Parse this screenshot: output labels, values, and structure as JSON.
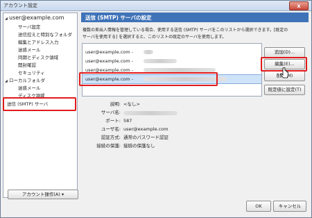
{
  "window": {
    "title": "アカウント設定",
    "close_glyph": "x"
  },
  "sidebar": {
    "account": "user@example.com",
    "account_items": [
      "サーバ設定",
      "送信控えと特別なフォルダ",
      "編集とアドレス入力",
      "迷惑メール",
      "同期とディスク領域",
      "開封確認",
      "セキュリティ"
    ],
    "local": "ローカルフォルダ",
    "local_items": [
      "迷惑メール",
      "ディスク領域"
    ],
    "smtp": "送信 (SMTP) サーバ",
    "account_actions": "アカウント操作(A)"
  },
  "panel": {
    "title": "送信 (SMTP) サーバの設定",
    "description_1": "複数の差出人情報を管理している場合、使用する送信 (SMTP) サーバをこのリストから選択できます。[既定の",
    "description_2": "サーバを使用する] を選択すると、このリストの既定のサーバを使用します。"
  },
  "servers": [
    {
      "email": "user@example.com",
      "dash": "-"
    },
    {
      "email": "user@example.com",
      "dash": "-"
    },
    {
      "email": "user@example.com",
      "dash": "-"
    },
    {
      "email": "user@example.com",
      "dash": "-",
      "selected": true
    }
  ],
  "buttons": {
    "add": "追加(D)...",
    "edit": "編集(E)...",
    "remove": "削除(M)",
    "set_default": "既定値に設定(T)",
    "ok": "OK",
    "cancel": "キャンセル",
    "account_dropdown_glyph": "▾"
  },
  "details": {
    "description_label": "説明:",
    "description_value": "<なし>",
    "server_label": "サーバ名:",
    "port_label": "ポート:",
    "port_value": "587",
    "username_label": "ユーザ名:",
    "username_value": "user@example.com",
    "auth_label": "認証方式:",
    "auth_value": "通常のパスワード認証",
    "security_label": "接続の保護:",
    "security_value": "接続の保護なし"
  },
  "colors": {
    "accent": "#3f73b8",
    "highlight": "#e21b1b",
    "selection": "#cfe3f8"
  }
}
